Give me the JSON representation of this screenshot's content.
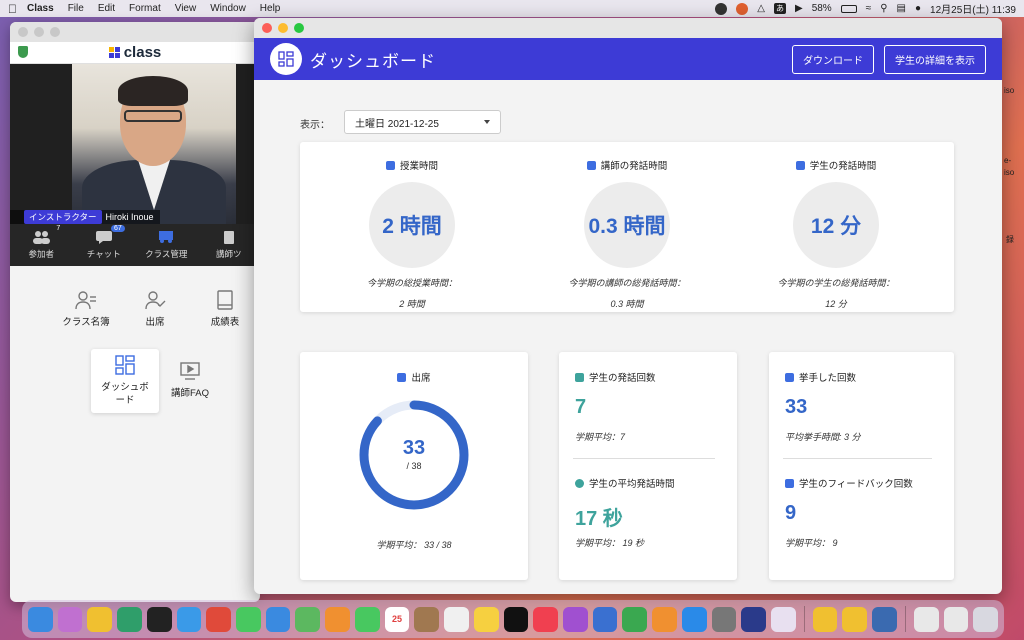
{
  "menubar": {
    "app_name": "Class",
    "menus": [
      "File",
      "Edit",
      "Format",
      "View",
      "Window",
      "Help"
    ],
    "battery": "58%",
    "datetime": "12月25日(土)  11:39"
  },
  "left_window": {
    "name_tag_role": "インストラクター",
    "name_tag_name": "Hiroki Inoue",
    "toolbar": [
      {
        "label": "参加者",
        "badge": "7"
      },
      {
        "label": "チャット",
        "badge": "67"
      },
      {
        "label": "クラス管理",
        "badge": ""
      },
      {
        "label": "講師ツ",
        "badge": ""
      }
    ],
    "grid": [
      {
        "label": "クラス名簿"
      },
      {
        "label": "出席"
      },
      {
        "label": "成績表"
      },
      {
        "label": "ダッシュボード"
      },
      {
        "label": "講師FAQ"
      }
    ]
  },
  "dashboard": {
    "title": "ダッシュボード",
    "download_label": "ダウンロード",
    "details_label": "学生の詳細を表示",
    "show_label": "表示：",
    "date_value": "土曜日 2021-12-25",
    "stats": [
      {
        "title": "授業時間",
        "value": "2 時間",
        "sub": "今学期の総授業時間：",
        "sub_value": "2 時間"
      },
      {
        "title": "講師の発話時間",
        "value": "0.3 時間",
        "sub": "今学期の講師の総発話時間：",
        "sub_value": "0.3 時間"
      },
      {
        "title": "学生の発話時間",
        "value": "12 分",
        "sub": "今学期の学生の総発話時間：",
        "sub_value": "12 分"
      }
    ],
    "attendance": {
      "title": "出席",
      "present": "33",
      "total": "/ 38",
      "fill": 0.868,
      "sub": "学期平均： 33 / 38"
    },
    "speech": {
      "count_title": "学生の発話回数",
      "count_value": "7",
      "count_sub": "学期平均：7",
      "avg_title": "学生の平均発話時間",
      "avg_value": "17 秒",
      "avg_sub": "学期平均： 19 秒"
    },
    "hands": {
      "raise_title": "挙手した回数",
      "raise_value": "33",
      "raise_sub": "平均挙手時間: 3 分",
      "feedback_title": "学生のフィードバック回数",
      "feedback_value": "9",
      "feedback_sub": "学期平均： 9"
    }
  },
  "side_texts": [
    "iso",
    "e-",
    "iso",
    "録"
  ],
  "dock": {
    "calendar_day": "25"
  }
}
